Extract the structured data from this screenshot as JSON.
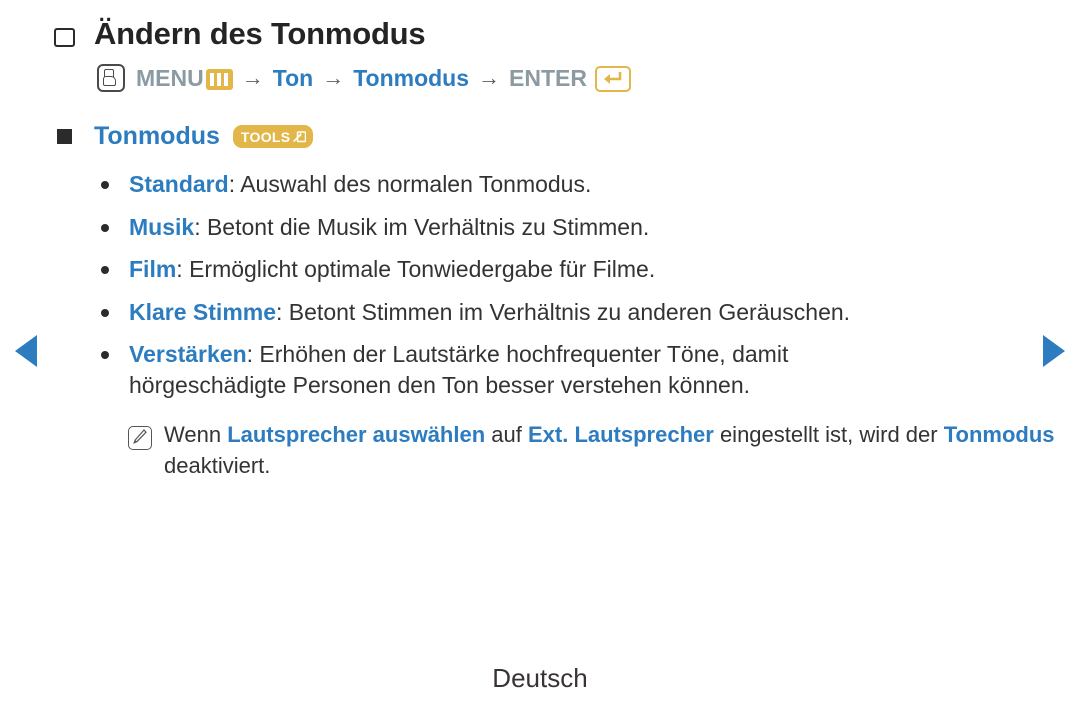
{
  "nav": {
    "prev_label": "◀",
    "next_label": "▶"
  },
  "title": {
    "text": "Ändern des Tonmodus"
  },
  "menu_path": {
    "hand_icon": "hand-press-icon",
    "menu_label": "MENU",
    "menu_icon": "menu-bars-icon",
    "arrow": "→",
    "step1": "Ton",
    "step2": "Tonmodus",
    "enter_label": "ENTER",
    "enter_icon": "enter-return-icon"
  },
  "section": {
    "label": "Tonmodus",
    "badge": "TOOLS",
    "badge_icon": "tools-arrow-icon"
  },
  "options": [
    {
      "keyword": "Standard",
      "separator": ": ",
      "description": "Auswahl des normalen Tonmodus."
    },
    {
      "keyword": "Musik",
      "separator": ": ",
      "description": "Betont die Musik im Verhältnis zu Stimmen."
    },
    {
      "keyword": "Film",
      "separator": ": ",
      "description": "Ermöglicht optimale Tonwiedergabe für Filme."
    },
    {
      "keyword": "Klare Stimme",
      "separator": ": ",
      "description": "Betont Stimmen im Verhältnis zu anderen Geräuschen."
    },
    {
      "keyword": "Verstärken",
      "separator": ": ",
      "description": "Erhöhen der Lautstärke hochfrequenter Töne, damit hörgeschädigte Personen den Ton besser verstehen können."
    }
  ],
  "note": {
    "icon": "note-pen-icon",
    "part1": "Wenn ",
    "kw1": "Lautsprecher auswählen",
    "part2": " auf ",
    "kw2": "Ext. Lautsprecher",
    "part3": " eingestellt ist, wird der ",
    "kw3": "Tonmodus",
    "part4": " deaktiviert."
  },
  "footer": {
    "language": "Deutsch"
  },
  "colors": {
    "accent_blue": "#2c7cbf",
    "accent_gold": "#e3b64a",
    "text": "#333333",
    "gray": "#8b9aa3"
  }
}
